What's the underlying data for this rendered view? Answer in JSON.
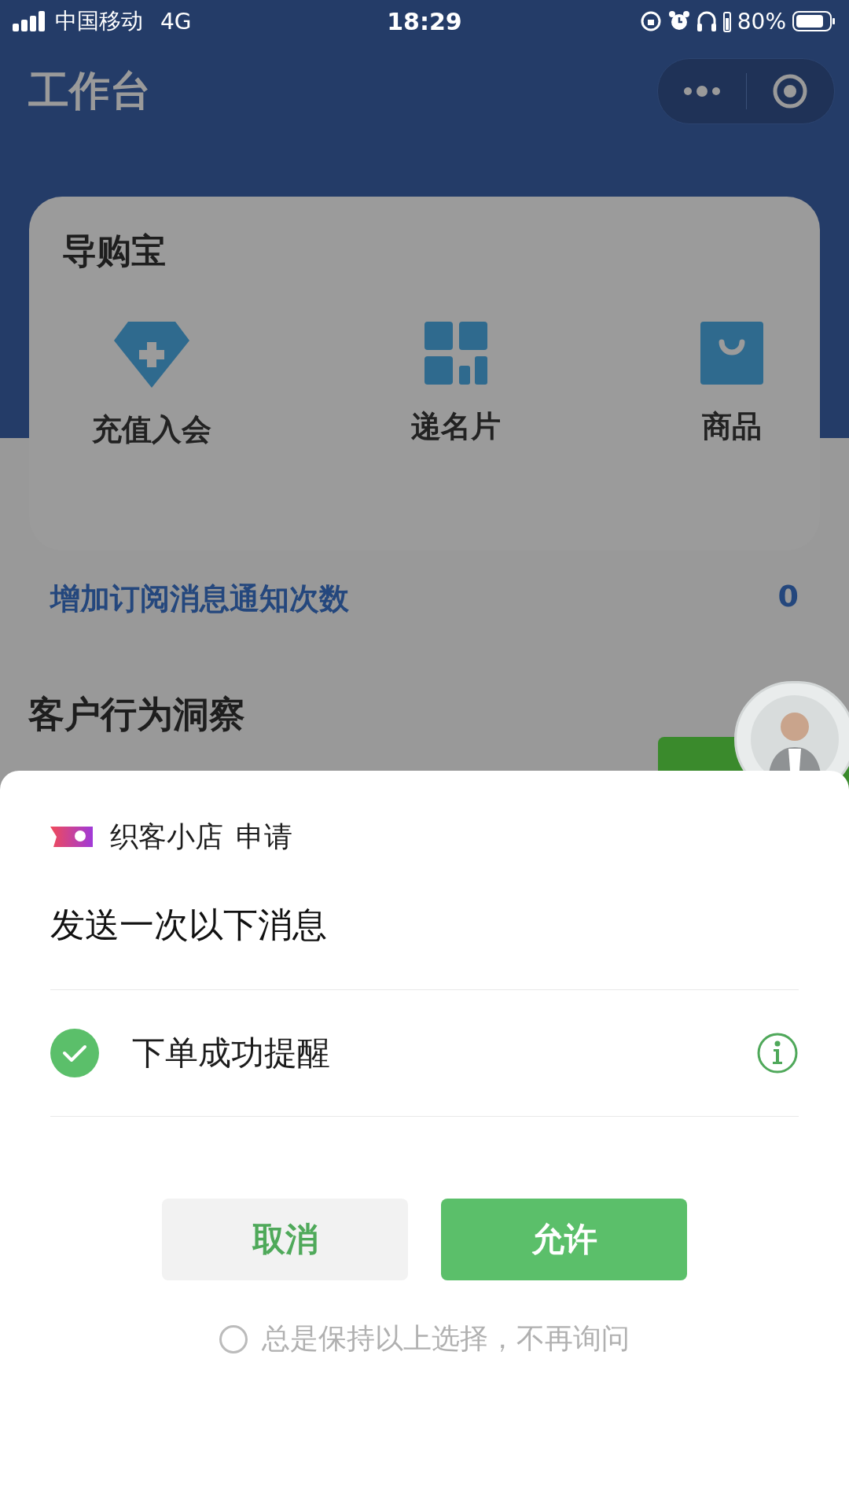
{
  "status_bar": {
    "carrier": "中国移动",
    "network": "4G",
    "time": "18:29",
    "battery": "80%"
  },
  "nav": {
    "title": "工作台"
  },
  "card": {
    "title": "导购宝",
    "actions": [
      {
        "label": "充值入会",
        "kind": "diamond"
      },
      {
        "label": "递名片",
        "kind": "grid"
      },
      {
        "label": "商品",
        "kind": "bag"
      }
    ]
  },
  "subscribe_link": {
    "label": "增加订阅消息通知次数",
    "count": "0"
  },
  "section_title": "客户行为洞察",
  "sheet": {
    "app_name": "织客小店",
    "action": "申请",
    "prompt": "发送一次以下消息",
    "options": [
      {
        "label": "下单成功提醒",
        "checked": true
      }
    ],
    "buttons": [
      {
        "label": "取消",
        "kind": "secondary"
      },
      {
        "label": "允许",
        "kind": "primary"
      }
    ],
    "remember": {
      "label": "总是保持以上选择，不再询问",
      "checked": false
    }
  }
}
